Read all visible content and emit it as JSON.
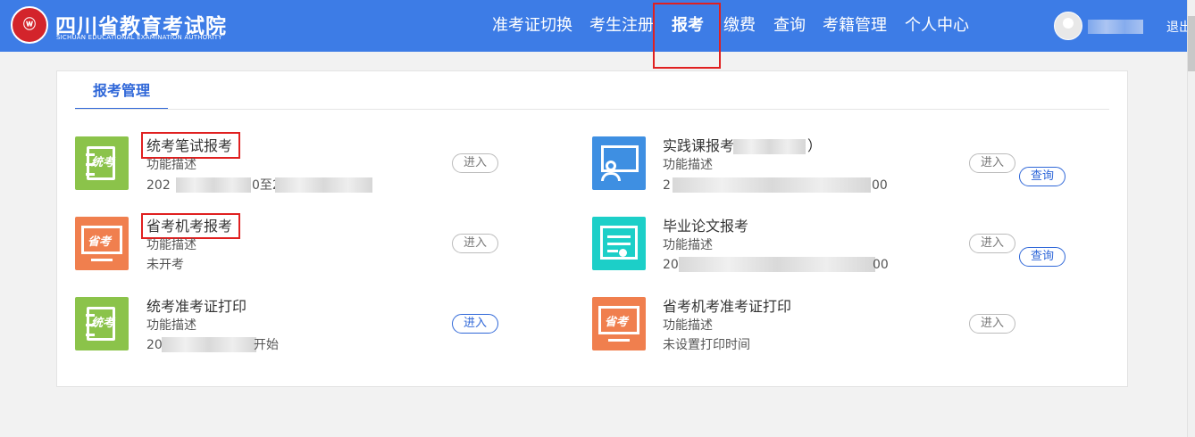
{
  "header": {
    "logo_mark": "ⓦ",
    "logo_cn": "四川省教育考试院",
    "logo_en": "SICHUAN EDUCATIONAL EXAMINATION AUTHORITY",
    "nav": [
      "准考证切换",
      "考生注册",
      "报考",
      "缴费",
      "查询",
      "考籍管理",
      "个人中心"
    ],
    "active_nav": "报考",
    "logout": "退出"
  },
  "tab": {
    "label": "报考管理"
  },
  "cards": {
    "c1": {
      "title": "统考笔试报考",
      "desc": "功能描述",
      "time_prefix": "202",
      "time_mid": "0至2",
      "button": "进入"
    },
    "c2": {
      "title": "实践课报考",
      "title_suffix": "）",
      "desc": "功能描述",
      "time_prefix": "2",
      "time_suffix": "00",
      "button": "进入",
      "query": "查询"
    },
    "c3": {
      "title": "省考机考报考",
      "desc": "功能描述",
      "time": "未开考",
      "button": "进入"
    },
    "c4": {
      "title": "毕业论文报考",
      "desc": "功能描述",
      "time_prefix": "20",
      "time_suffix": "00",
      "button": "进入",
      "query": "查询"
    },
    "c5": {
      "title": "统考准考证打印",
      "desc": "功能描述",
      "time_prefix": "20",
      "time_suffix": "开始",
      "button": "进入"
    },
    "c6": {
      "title": "省考机考准考证打印",
      "desc": "功能描述",
      "time": "未设置打印时间",
      "button": "进入"
    }
  },
  "icons": {
    "exam_pad": "统考",
    "monitor_exam": "省考"
  },
  "colors": {
    "header": "#3d7ce6",
    "accent": "#2f67d8",
    "highlight": "#e02020",
    "green": "#8bc34a",
    "orange": "#f07f4e",
    "blue": "#3e8fe2",
    "teal": "#1ccfc8"
  }
}
